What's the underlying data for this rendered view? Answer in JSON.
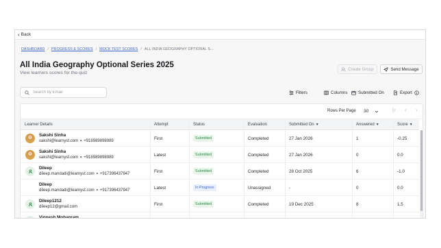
{
  "topbar": {
    "back_label": "Back"
  },
  "breadcrumb": {
    "items": [
      "DASHBOARD",
      "PROGRESS & SCORES",
      "MOCK TEST SCORES"
    ],
    "current": "ALL INDIA GEOGRAPHY OPTIONAL S..."
  },
  "page": {
    "title": "All India Geography Optional Series 2025",
    "subtitle": "View learners scores for the quiz"
  },
  "actions": {
    "create_group": "Create Group",
    "send_message": "Send Message"
  },
  "search": {
    "placeholder": "Search by Email",
    "value": ""
  },
  "toolbar": {
    "filters": "Filters",
    "columns": "Columns",
    "submitted_on": "Submitted On",
    "export": "Export"
  },
  "pagination": {
    "rows_per_page_label": "Rows Per Page",
    "rows_per_page": "30"
  },
  "table": {
    "headers": {
      "learner": "Learner Details",
      "attempt": "Attempt",
      "status": "Status",
      "evaluation": "Evaluation",
      "submitted_on": "Submitted On",
      "answered": "Answered",
      "score": "Score"
    },
    "rows": [
      {
        "name": "Sakshi Sinha",
        "email": "sakshi@learnyst.com",
        "phone": "+918989898989",
        "avatar": "photo",
        "attempt": "First",
        "status": "Submitted",
        "evaluation": "Completed",
        "submitted_on": "27 Jan 2026",
        "answered": "1",
        "score": "-0.25"
      },
      {
        "name": "Sakshi Sinha",
        "email": "sakshi@learnyst.com",
        "phone": "+918989898989",
        "avatar": "photo",
        "attempt": "Latest",
        "status": "Submitted",
        "evaluation": "Completed",
        "submitted_on": "27 Jan 2026",
        "answered": "0",
        "score": "0.0"
      },
      {
        "name": "Dileep",
        "email": "dileep.mandadi@learnyst.com",
        "phone": "+917396437947",
        "avatar": "default",
        "attempt": "First",
        "status": "Submitted",
        "evaluation": "Completed",
        "submitted_on": "28 Oct 2025",
        "answered": "6",
        "score": "-1.0"
      },
      {
        "name": "Dileep",
        "email": "dileep.mandadi@learnyst.com",
        "phone": "+917396437947",
        "avatar": "none",
        "attempt": "Latest",
        "status": "In Progress",
        "evaluation": "Unassigned",
        "submitted_on": "-",
        "answered": "0",
        "score": "0.0"
      },
      {
        "name": "Dileep1212",
        "email": "dileep12@gmail.com",
        "phone": "",
        "avatar": "default",
        "attempt": "First",
        "status": "Submitted",
        "evaluation": "Completed",
        "submitted_on": "19 Dec 2025",
        "answered": "8",
        "score": "1.5"
      },
      {
        "name": "Vignesh Mohanram",
        "email": "",
        "phone": "",
        "avatar": "default",
        "attempt": "",
        "status": "",
        "evaluation": "",
        "submitted_on": "",
        "answered": "",
        "score": ""
      }
    ]
  },
  "colors": {
    "link": "#3c64c8",
    "submitted_badge": "#2f8a45",
    "progress_badge": "#3c64c8"
  }
}
